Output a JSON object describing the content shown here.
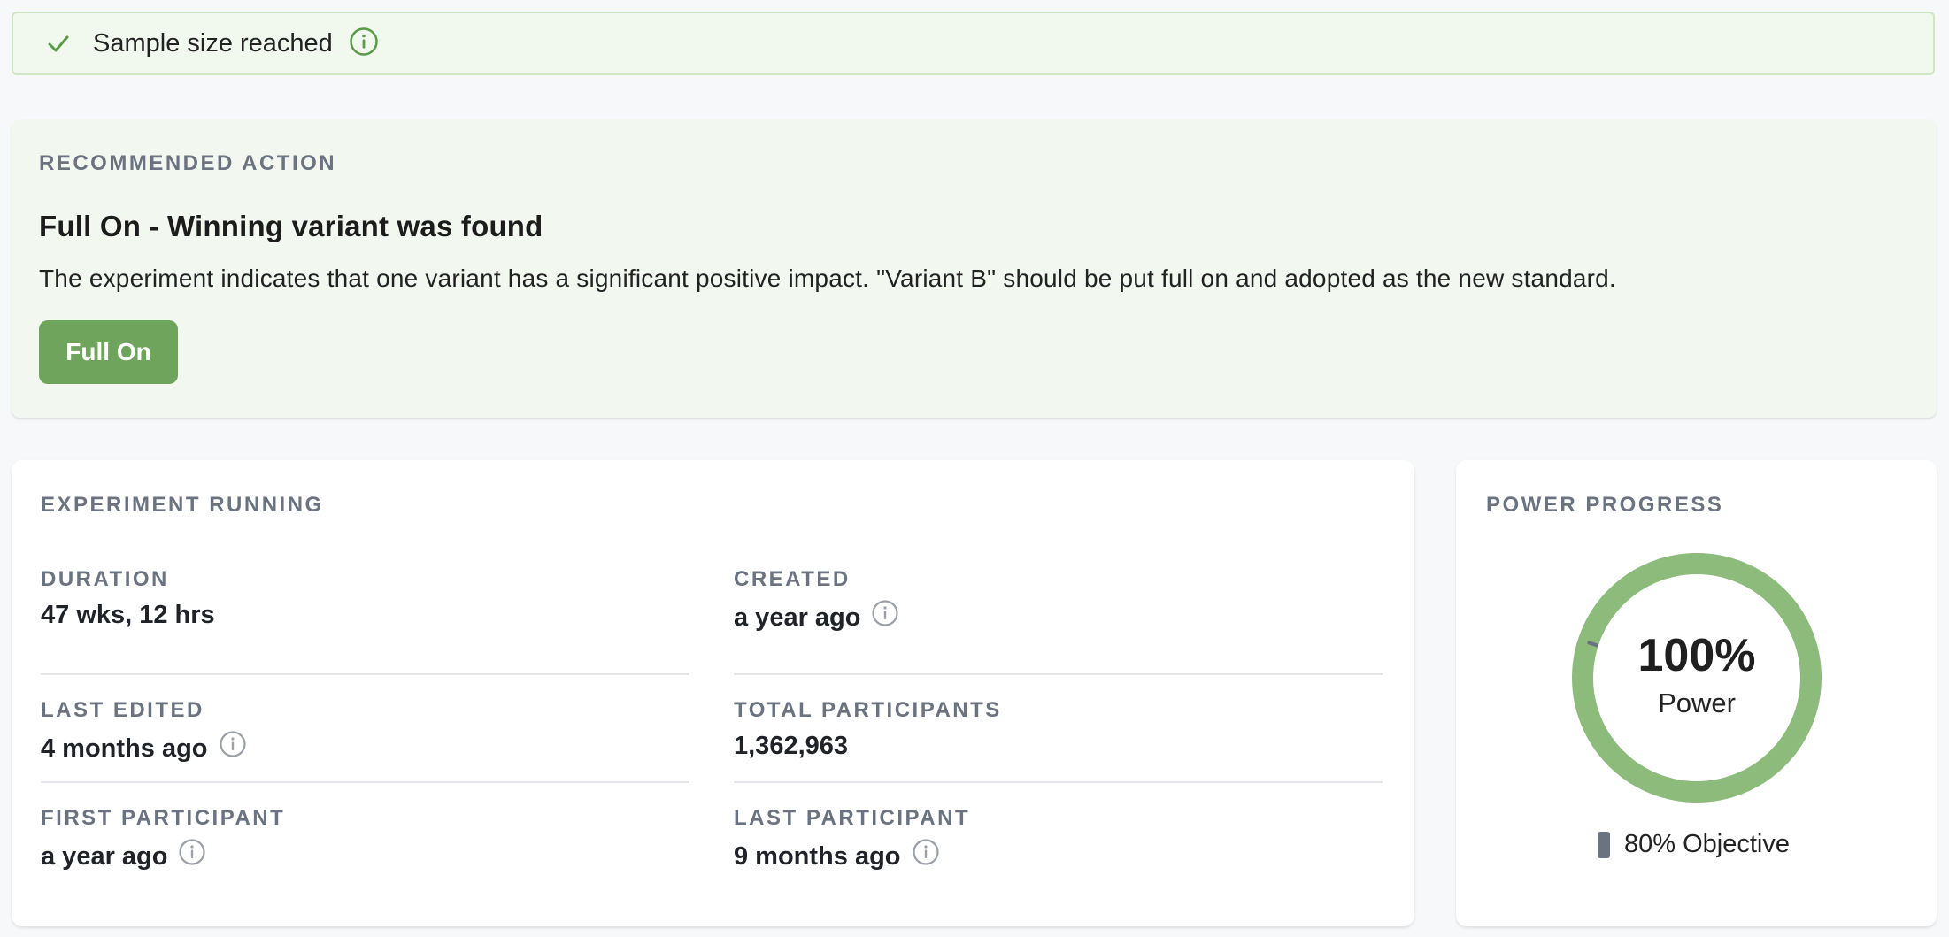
{
  "banner": {
    "text": "Sample size reached",
    "status_color": "#5a9a48"
  },
  "recommended": {
    "label": "RECOMMENDED ACTION",
    "title": "Full On - Winning variant was found",
    "description": "The experiment indicates that one variant has a significant positive impact. \"Variant B\" should be put full on and adopted as the new standard.",
    "button_label": "Full On",
    "button_color": "#6ea45c"
  },
  "experiment": {
    "label": "EXPERIMENT RUNNING",
    "stats": {
      "duration": {
        "label": "DURATION",
        "value": "47 wks, 12 hrs"
      },
      "created": {
        "label": "CREATED",
        "value": "a year ago"
      },
      "last_edited": {
        "label": "LAST EDITED",
        "value": "4 months ago"
      },
      "total_participants": {
        "label": "TOTAL PARTICIPANTS",
        "value": "1,362,963"
      },
      "first_participant": {
        "label": "FIRST PARTICIPANT",
        "value": "a year ago"
      },
      "last_participant": {
        "label": "LAST PARTICIPANT",
        "value": "9 months ago"
      }
    }
  },
  "power": {
    "label": "POWER PROGRESS",
    "percent_text": "100%",
    "percent_value": 100,
    "sub_label": "Power",
    "objective_text": "80% Objective",
    "objective_value": 80,
    "ring_color": "#8dbb7b",
    "marker_color": "#6b7280"
  },
  "icons": [
    "check-icon",
    "info-icon"
  ]
}
